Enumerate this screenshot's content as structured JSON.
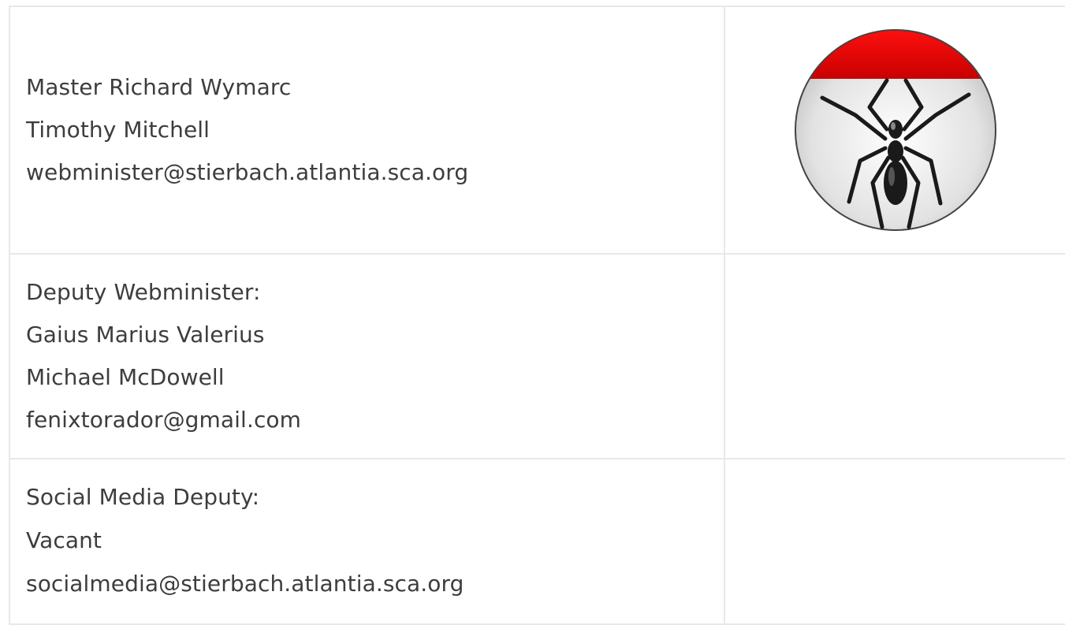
{
  "officers": [
    {
      "lines": [
        "Master Richard Wymarc",
        "Timothy Mitchell",
        "webminister@stierbach.atlantia.sca.org"
      ]
    },
    {
      "lines": [
        "Deputy Webminister:",
        "Gaius Marius Valerius",
        "Michael McDowell",
        "fenixtorador@gmail.com"
      ]
    },
    {
      "lines": [
        "Social Media Deputy:",
        "Vacant",
        "socialmedia@stierbach.atlantia.sca.org"
      ]
    }
  ],
  "badge": {
    "icon": "spider-badge-icon",
    "chief_color": "#e00000",
    "field_color": "#e2e2e2",
    "spider_color": "#1a1a1a"
  }
}
